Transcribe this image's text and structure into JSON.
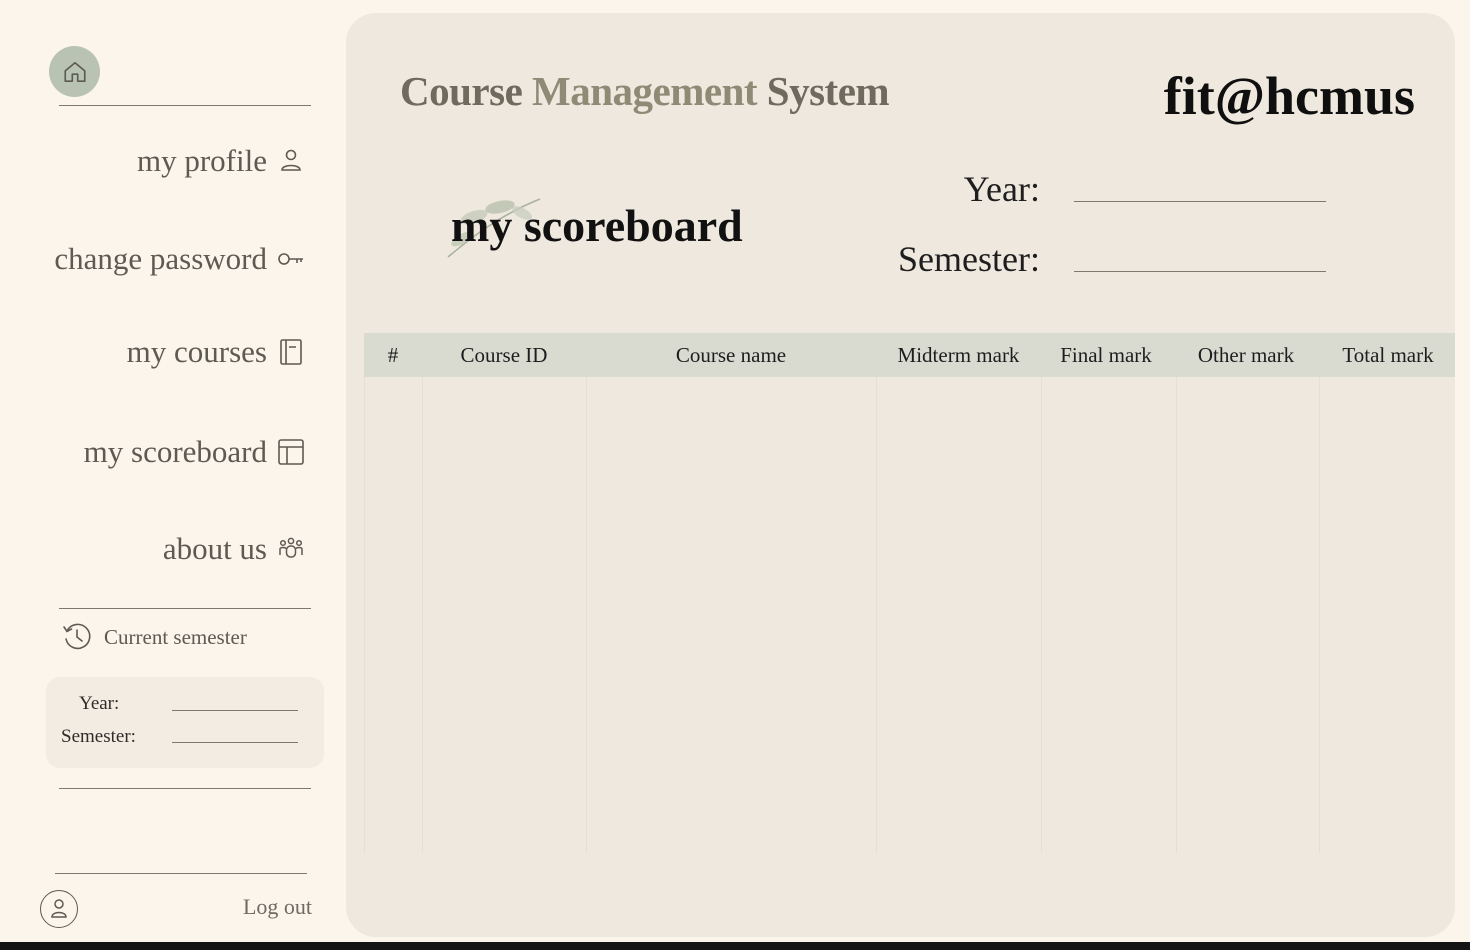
{
  "sidebar": {
    "nav": [
      {
        "label": "my profile",
        "icon": "user-icon"
      },
      {
        "label": "change password",
        "icon": "key-icon"
      },
      {
        "label": "my courses",
        "icon": "book-icon"
      },
      {
        "label": "my scoreboard",
        "icon": "layout-icon"
      },
      {
        "label": "about us",
        "icon": "group-icon"
      }
    ],
    "current_semester": {
      "label": "Current semester",
      "year_label": "Year:",
      "semester_label": "Semester:"
    },
    "logout_label": "Log out"
  },
  "header": {
    "app_title_a": "Course ",
    "app_title_b": "Management",
    "app_title_c": " System",
    "brand": "fit@hcmus"
  },
  "page": {
    "title": "my scoreboard",
    "year_label": "Year:",
    "semester_label": "Semester:"
  },
  "table": {
    "columns": [
      "#",
      "Course ID",
      "Course name",
      "Midterm mark",
      "Final mark",
      "Other mark",
      "Total mark"
    ],
    "rows": []
  },
  "colors": {
    "background": "#fbf5ec",
    "panel": "#efe8de",
    "table_header": "#d9dbd0",
    "home_button": "#b9c3b3"
  }
}
